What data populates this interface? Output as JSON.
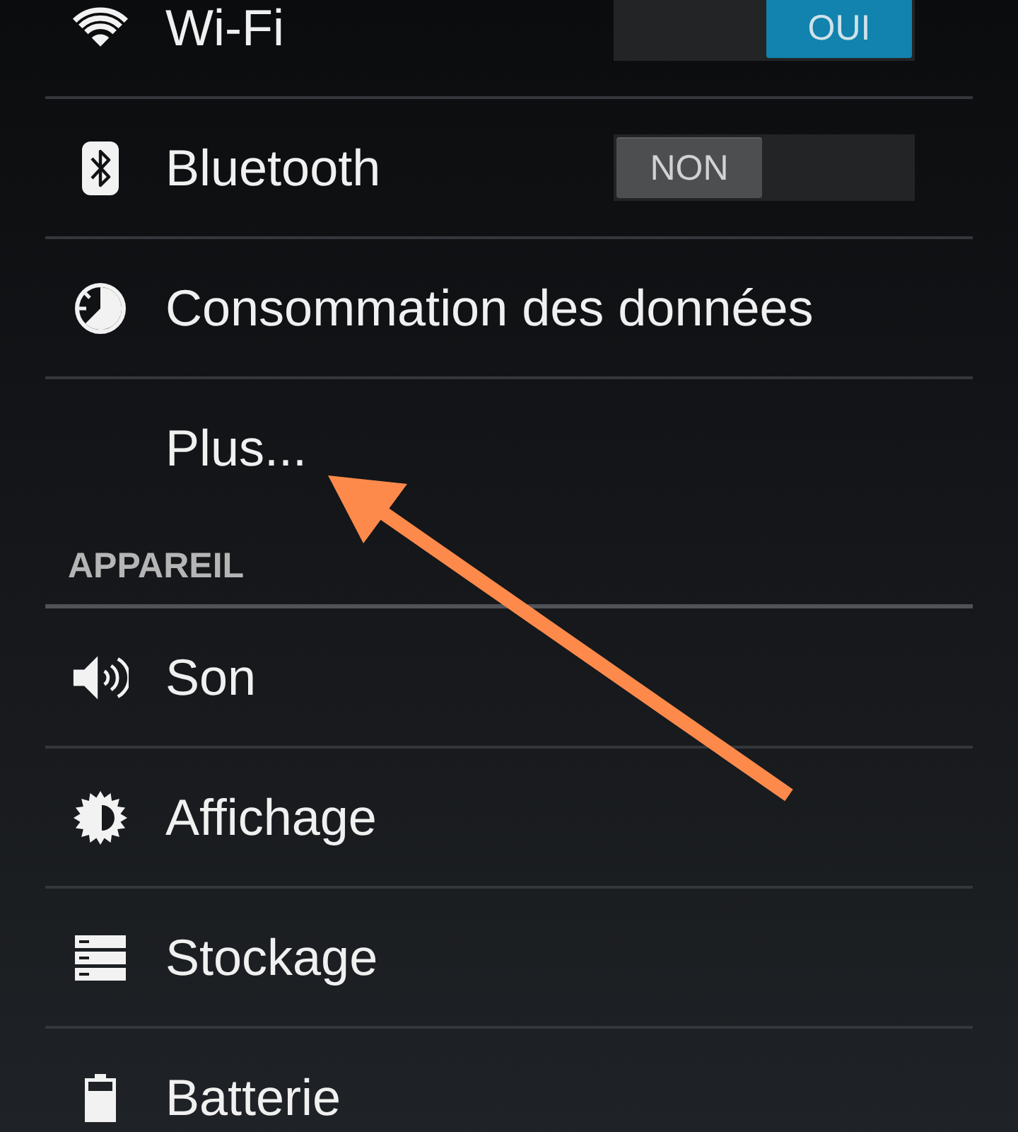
{
  "sections": [
    {
      "items": [
        {
          "label": "Wi-Fi",
          "toggle": {
            "on": true,
            "label": "OUI"
          }
        },
        {
          "label": "Bluetooth",
          "toggle": {
            "on": false,
            "label": "NON"
          }
        },
        {
          "label": "Consommation des données"
        },
        {
          "label": "Plus..."
        }
      ]
    },
    {
      "header": "APPAREIL",
      "items": [
        {
          "label": "Son"
        },
        {
          "label": "Affichage"
        },
        {
          "label": "Stockage"
        },
        {
          "label": "Batterie"
        }
      ]
    }
  ],
  "annotations": [
    {
      "kind": "arrow"
    }
  ]
}
